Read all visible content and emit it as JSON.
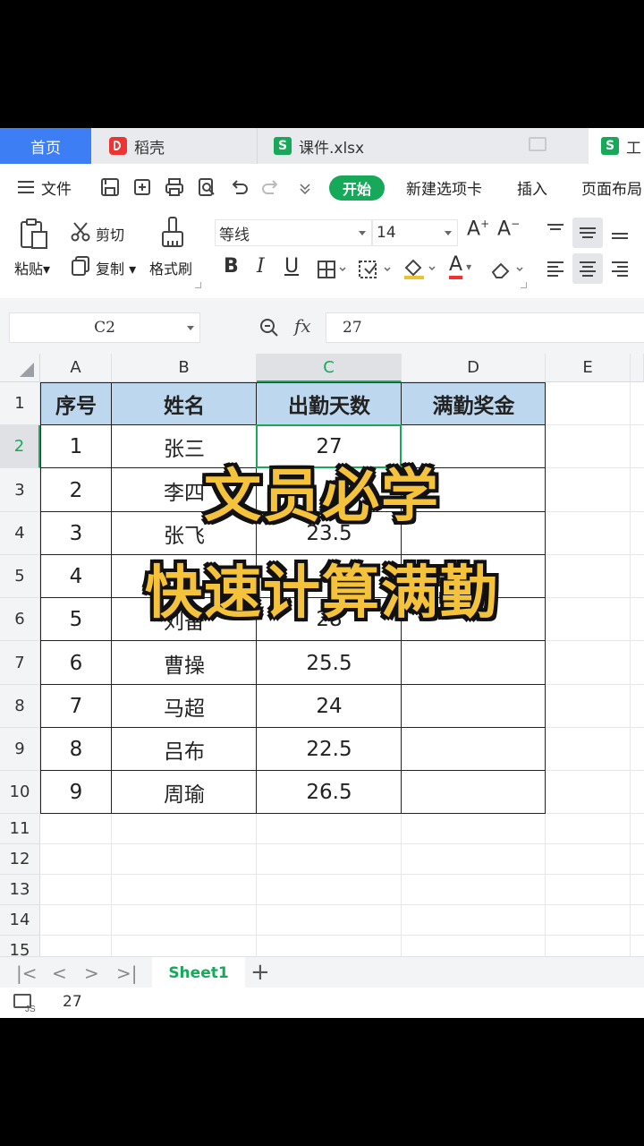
{
  "tabs": {
    "home": "首页",
    "daoke": "稻壳",
    "file1": "课件.xlsx",
    "file2": "工"
  },
  "menu": {
    "file": "文件",
    "start": "开始",
    "new_tab": "新建选项卡",
    "insert": "插入",
    "page_layout": "页面布局"
  },
  "ribbon": {
    "paste": "粘贴",
    "cut": "剪切",
    "copy": "复制",
    "format_painter": "格式刷",
    "font_name": "等线",
    "font_size": "14",
    "font_grow": "A",
    "font_shrink": "A",
    "bold": "B",
    "italic": "I",
    "underline": "U",
    "font_color_letter": "A"
  },
  "formula_bar": {
    "cell_ref": "C2",
    "fx": "fx",
    "value": "27"
  },
  "columns": [
    "A",
    "B",
    "C",
    "D",
    "E"
  ],
  "rows": [
    "1",
    "2",
    "3",
    "4",
    "5",
    "6",
    "7",
    "8",
    "9",
    "10",
    "11",
    "12",
    "13",
    "14",
    "15"
  ],
  "table": {
    "headers": [
      "序号",
      "姓名",
      "出勤天数",
      "满勤奖金"
    ],
    "rows": [
      [
        "1",
        "张三",
        "27",
        ""
      ],
      [
        "2",
        "李四",
        "",
        ""
      ],
      [
        "3",
        "张飞",
        "23.5",
        ""
      ],
      [
        "4",
        "",
        "2",
        ""
      ],
      [
        "5",
        "刘备",
        "28",
        ""
      ],
      [
        "6",
        "曹操",
        "25.5",
        ""
      ],
      [
        "7",
        "马超",
        "24",
        ""
      ],
      [
        "8",
        "吕布",
        "22.5",
        ""
      ],
      [
        "9",
        "周瑜",
        "26.5",
        ""
      ]
    ]
  },
  "overlay": {
    "line1": "文员必学",
    "line2": "快速计算满勤"
  },
  "sheet": {
    "name": "Sheet1",
    "add": "+"
  },
  "status": {
    "value": "27"
  },
  "colors": {
    "accent": "#16a95a",
    "home_tab": "#3d7ef5",
    "header_fill": "#bdd7ee",
    "overlay_text": "#f5c33b"
  }
}
